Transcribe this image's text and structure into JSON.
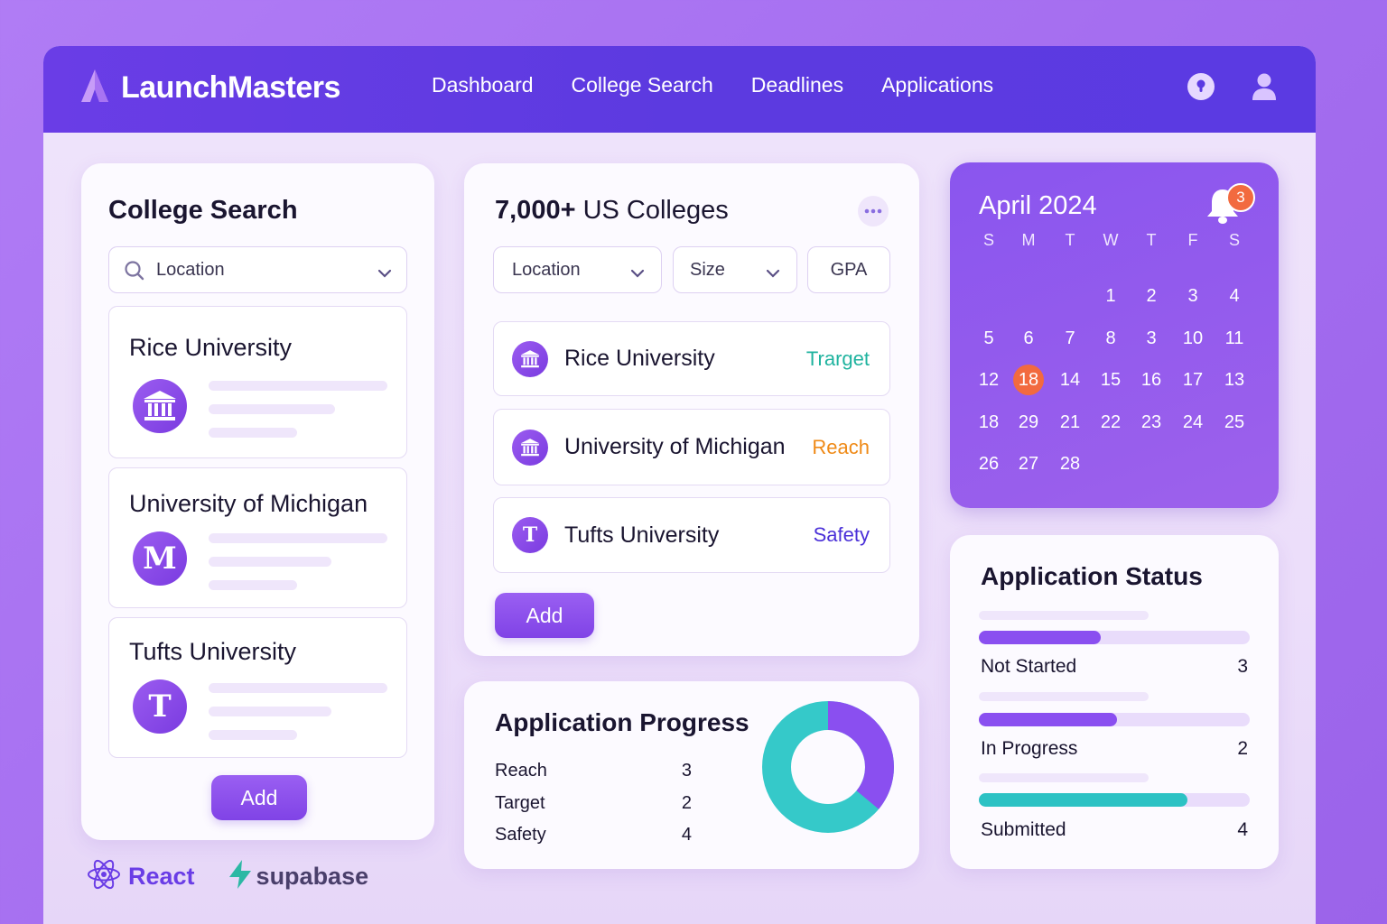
{
  "app": {
    "title": "LaunchMasters"
  },
  "nav": {
    "items": [
      "Dashboard",
      "College Search",
      "Deadlines",
      "Applications"
    ],
    "help_icon": "help-icon",
    "profile_icon": "user-icon"
  },
  "college_search": {
    "title": "College Search",
    "location_placeholder": "Location",
    "universities": [
      {
        "name": "Rice University",
        "logo": "institution-icon"
      },
      {
        "name": "University of Michigan",
        "logo": "M"
      },
      {
        "name": "Tufts University",
        "logo": "T"
      }
    ],
    "add_label": "Add"
  },
  "colleges": {
    "count": "7,000+",
    "title_rest": " US Colleges",
    "filters": [
      "Location",
      "Size",
      "GPA"
    ],
    "rows": [
      {
        "name": "Rice University",
        "tag": "Trarget",
        "tag_color": "#1fb39f",
        "logo": "institution-icon"
      },
      {
        "name": "University of Michigan",
        "tag": "Reach",
        "tag_color": "#ef8a17",
        "logo": "institution-icon"
      },
      {
        "name": "Tufts University",
        "tag": "Safety",
        "tag_color": "#4a30d8",
        "logo": "T"
      }
    ],
    "add_label": "Add"
  },
  "progress": {
    "title": "Application Progress",
    "rows": [
      {
        "label": "Reach",
        "value": "3"
      },
      {
        "label": "Target",
        "value": "2"
      },
      {
        "label": "Safety",
        "value": "4"
      }
    ],
    "donut_colors": [
      "#8a4ff0",
      "#35c9c9"
    ]
  },
  "calendar": {
    "title": "April 2024",
    "notification_count": "3",
    "weekdays": [
      "S",
      "M",
      "T",
      "W",
      "T",
      "F",
      "S"
    ],
    "weeks": [
      [
        "",
        "",
        "",
        "1",
        "2",
        "3",
        "4"
      ],
      [
        "5",
        "6",
        "7",
        "8",
        "3",
        "10",
        "11"
      ],
      [
        "12",
        "18",
        "14",
        "15",
        "16",
        "17",
        "13"
      ],
      [
        "18",
        "29",
        "21",
        "22",
        "23",
        "24",
        "25"
      ],
      [
        "26",
        "27",
        "28",
        "",
        "",
        "",
        ""
      ]
    ],
    "highlighted": "18"
  },
  "status": {
    "title": "Application Status",
    "items": [
      {
        "label": "Not Started",
        "value": "3",
        "fill": 0.45,
        "color": "#8a4ff0"
      },
      {
        "label": "In Progress",
        "value": "2",
        "fill": 0.51,
        "color": "#8a4ff0"
      },
      {
        "label": "Submitted",
        "value": "4",
        "fill": 0.77,
        "color": "#2cc2c4"
      }
    ]
  },
  "footer": {
    "react": "React",
    "supabase": "supabase"
  }
}
